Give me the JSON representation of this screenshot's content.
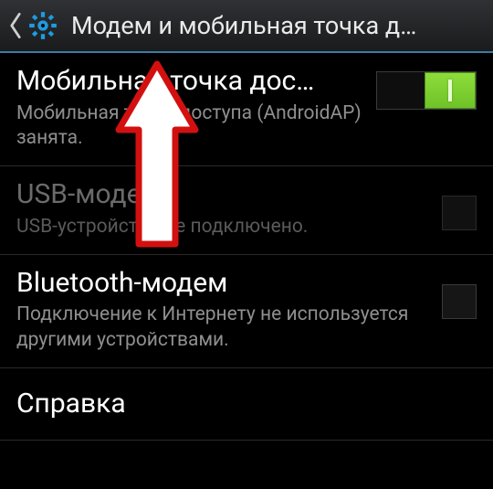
{
  "actionbar": {
    "title": "Модем и мобильная точка д…"
  },
  "rows": {
    "hotspot": {
      "label": "Мобильная точка дос…",
      "sub": "Мобильная точка доступа (AndroidAP) занята.",
      "toggle_on": true
    },
    "usb": {
      "label": "USB-модем",
      "sub": "USB-устройство не подключено."
    },
    "bt": {
      "label": "Bluetooth-модем",
      "sub": "Подключение к Интернету не используется другими устройствами."
    },
    "help": {
      "label": "Справка"
    }
  }
}
